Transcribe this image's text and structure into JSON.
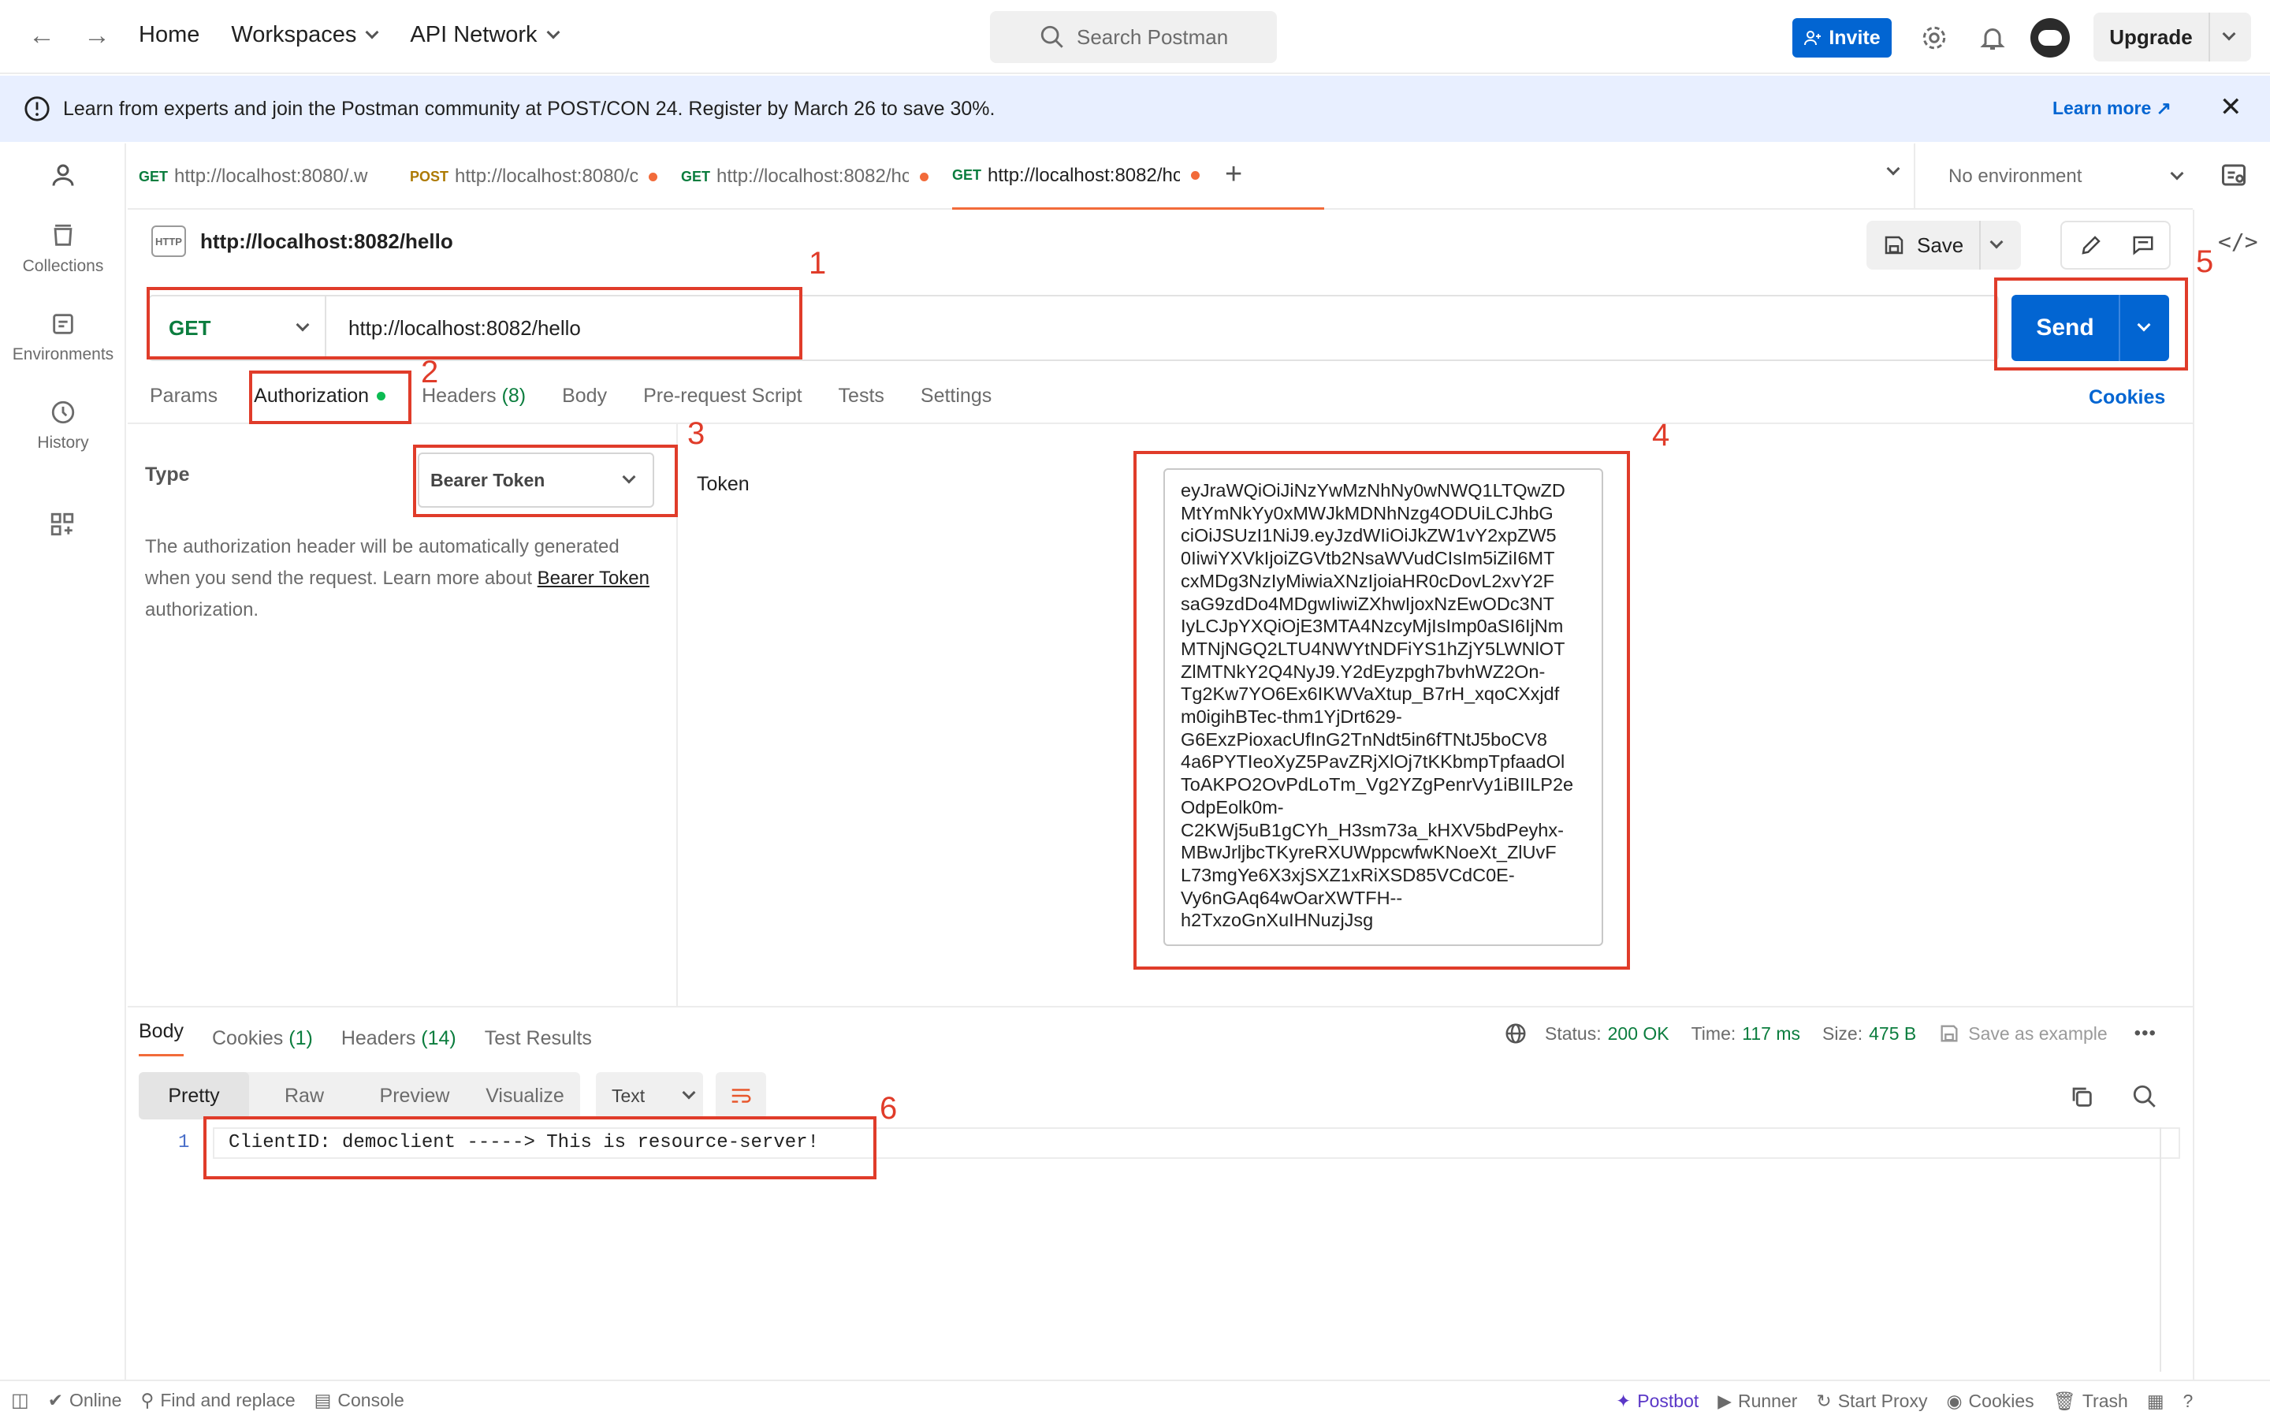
{
  "topbar": {
    "back_icon": "arrow-left-icon",
    "forward_icon": "arrow-right-icon",
    "home": "Home",
    "workspaces": "Workspaces",
    "api_network": "API Network",
    "search_placeholder": "Search Postman",
    "invite": "Invite",
    "upgrade": "Upgrade"
  },
  "banner": {
    "text": "Learn from experts and join the Postman community at POST/CON 24. Register by March 26 to save 30%.",
    "learn_more": "Learn more ↗"
  },
  "sidebar": {
    "items": [
      {
        "label": "Collections",
        "icon": "collections-icon"
      },
      {
        "label": "Environments",
        "icon": "environments-icon"
      },
      {
        "label": "History",
        "icon": "history-icon"
      }
    ]
  },
  "tabs": [
    {
      "method": "GET",
      "url": "http://localhost:8080/.w",
      "dirty": false
    },
    {
      "method": "POST",
      "url": "http://localhost:8080/c",
      "dirty": true
    },
    {
      "method": "GET",
      "url": "http://localhost:8082/hc",
      "dirty": true
    },
    {
      "method": "GET",
      "url": "http://localhost:8082/hc",
      "dirty": true,
      "active": true
    }
  ],
  "environment": "No environment",
  "request": {
    "badge": "HTTP",
    "title": "http://localhost:8082/hello",
    "save": "Save",
    "method": "GET",
    "url": "http://localhost:8082/hello",
    "send": "Send",
    "subtabs": {
      "params": "Params",
      "authorization": "Authorization",
      "headers": "Headers",
      "headers_count": "(8)",
      "body": "Body",
      "prerequest": "Pre-request Script",
      "tests": "Tests",
      "settings": "Settings"
    },
    "cookies": "Cookies"
  },
  "auth": {
    "type_label": "Type",
    "type_value": "Bearer Token",
    "help_1": "The authorization header will be automatically generated when you send the request. Learn more about",
    "help_link": "Bearer Token",
    "help_2": "authorization.",
    "token_label": "Token",
    "token_lines": [
      "eyJraWQiOiJiNzYwMzNhNy0wNWQ1LTQwZD",
      "MtYmNkYy0xMWJkMDNhNzg4ODUiLCJhbG",
      "ciOiJSUzI1NiJ9.eyJzdWIiOiJkZW1vY2xpZW5",
      "0IiwiYXVkIjoiZGVtb2NsaWVudCIsIm5iZiI6MT",
      "cxMDg3NzIyMiwiaXNzIjoiaHR0cDovL2xvY2F",
      "saG9zdDo4MDgwIiwiZXhwIjoxNzEwODc3NT",
      "IyLCJpYXQiOjE3MTA4NzcyMjIsImp0aSI6IjNm",
      "MTNjNGQ2LTU4NWYtNDFiYS1hZjY5LWNlOT",
      "ZlMTNkY2Q4NyJ9.Y2dEyzpgh7bvhWZ2On-",
      "Tg2Kw7YO6Ex6IKWVaXtup_B7rH_xqoCXxjdf",
      "m0igihBTec-thm1YjDrt629-",
      "G6ExzPioxacUfInG2TnNdt5in6fTNtJ5boCV8",
      "4a6PYTIeoXyZ5PavZRjXlOj7tKKbmpTpfaadOl",
      "ToAKPO2OvPdLoTm_Vg2YZgPenrVy1iBIILP2e",
      "OdpEolk0m-",
      "C2KWj5uB1gCYh_H3sm73a_kHXV5bdPeyhx-",
      "MBwJrljbcTKyreRXUWppcwfwKNoeXt_ZlUvF",
      "L73mgYe6X3xjSXZ1xRiXSD85VCdC0E-",
      "Vy6nGAq64wOarXWTFH--",
      "h2TxzoGnXuIHNuzjJsg"
    ]
  },
  "response": {
    "tabs": {
      "body": "Body",
      "cookies": "Cookies",
      "cookies_count": "(1)",
      "headers": "Headers",
      "headers_count": "(14)",
      "test_results": "Test Results"
    },
    "status_label": "Status:",
    "status": "200 OK",
    "time_label": "Time:",
    "time": "117 ms",
    "size_label": "Size:",
    "size": "475 B",
    "save_example": "Save as example",
    "views": [
      "Pretty",
      "Raw",
      "Preview",
      "Visualize"
    ],
    "format": "Text",
    "line_no": "1",
    "body_text": "ClientID: democlient -----> This is resource-server!"
  },
  "annotations": [
    "1",
    "2",
    "3",
    "4",
    "5",
    "6"
  ],
  "statusbar": {
    "online": "Online",
    "find_replace": "Find and replace",
    "console": "Console",
    "postbot": "Postbot",
    "runner": "Runner",
    "start_proxy": "Start Proxy",
    "cookies": "Cookies",
    "trash": "Trash"
  },
  "colors": {
    "accent_blue": "#0265d2",
    "tab_underline": "#f26b3a",
    "get_green": "#0b7d3e",
    "post_amber": "#ad7a03",
    "annotation_red": "#e03c2a",
    "banner_bg": "#e8efff"
  }
}
